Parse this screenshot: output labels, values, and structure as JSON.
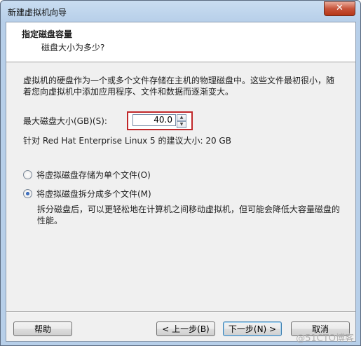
{
  "window": {
    "title": "新建虚拟机向导",
    "close_glyph": "✕"
  },
  "header": {
    "title": "指定磁盘容量",
    "subtitle": "磁盘大小为多少?"
  },
  "description": "虚拟机的硬盘作为一个或多个文件存储在主机的物理磁盘中。这些文件最初很小，随着您向虚拟机中添加应用程序、文件和数据而逐渐变大。",
  "disk_size": {
    "label": "最大磁盘大小(GB)(S):",
    "value": "40.0"
  },
  "recommendation": "针对 Red Hat Enterprise Linux 5 的建议大小: 20 GB",
  "options": [
    {
      "label": "将虚拟磁盘存储为单个文件(O)",
      "selected": false
    },
    {
      "label": "将虚拟磁盘拆分成多个文件(M)",
      "selected": true
    }
  ],
  "split_description": "拆分磁盘后，可以更轻松地在计算机之间移动虚拟机，但可能会降低大容量磁盘的性能。",
  "buttons": {
    "help": "帮助",
    "back": "< 上一步(B)",
    "next": "下一步(N) >",
    "cancel": "取消"
  },
  "watermark": "@51CTO博客"
}
